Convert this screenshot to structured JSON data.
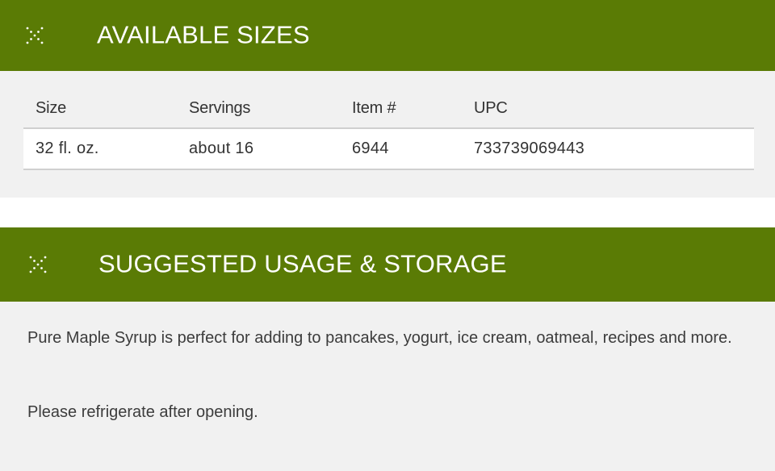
{
  "sizes_section": {
    "title": "AVAILABLE SIZES",
    "toggle_icon": "collapse-x-icon",
    "table": {
      "headers": [
        "Size",
        "Servings",
        "Item #",
        "UPC"
      ],
      "rows": [
        [
          "32 fl. oz.",
          "about 16",
          "6944",
          "733739069443"
        ]
      ]
    }
  },
  "usage_section": {
    "title": "SUGGESTED USAGE & STORAGE",
    "toggle_icon": "collapse-x-icon",
    "paragraphs": [
      "Pure Maple Syrup is perfect for adding to pancakes, yogurt, ice cream, oatmeal, recipes and more.",
      "Please refrigerate after opening."
    ]
  },
  "colors": {
    "header_bg": "#5a7b05",
    "header_text": "#ffffff",
    "panel_bg": "#f1f1f1",
    "body_text": "#3a3a3a"
  }
}
